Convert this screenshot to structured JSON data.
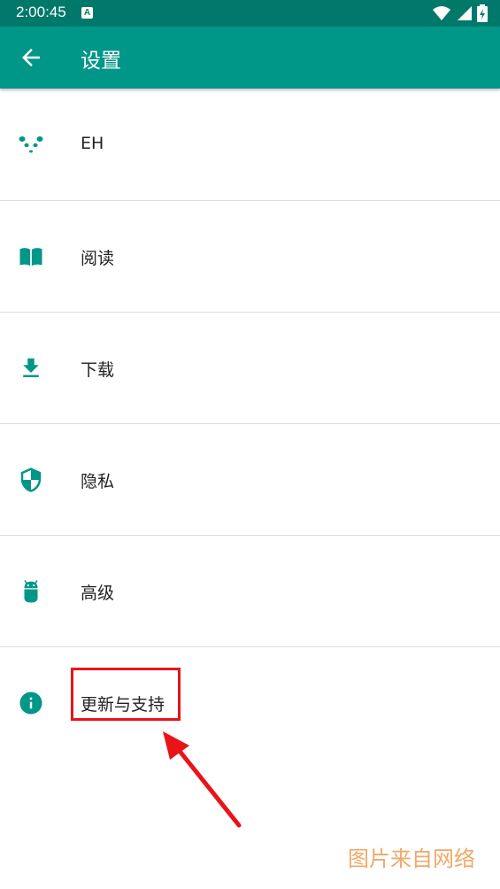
{
  "status_bar": {
    "time": "2:00:45",
    "notification_icon": "A",
    "wifi_icon": "wifi-icon",
    "signal_icon": "signal-icon",
    "battery_icon": "battery-charging-icon"
  },
  "appbar": {
    "title": "设置",
    "back_icon": "arrow-back-icon"
  },
  "settings": [
    {
      "label": "EH",
      "icon": "panda-icon"
    },
    {
      "label": "阅读",
      "icon": "book-icon"
    },
    {
      "label": "下载",
      "icon": "download-icon"
    },
    {
      "label": "隐私",
      "icon": "shield-icon"
    },
    {
      "label": "高级",
      "icon": "android-icon"
    },
    {
      "label": "更新与支持",
      "icon": "info-icon"
    }
  ],
  "watermark": "图片来自网络",
  "colors": {
    "status_bar": "#00796B",
    "app_bar": "#009688",
    "accent": "#009688",
    "highlight": "#e8141a"
  }
}
